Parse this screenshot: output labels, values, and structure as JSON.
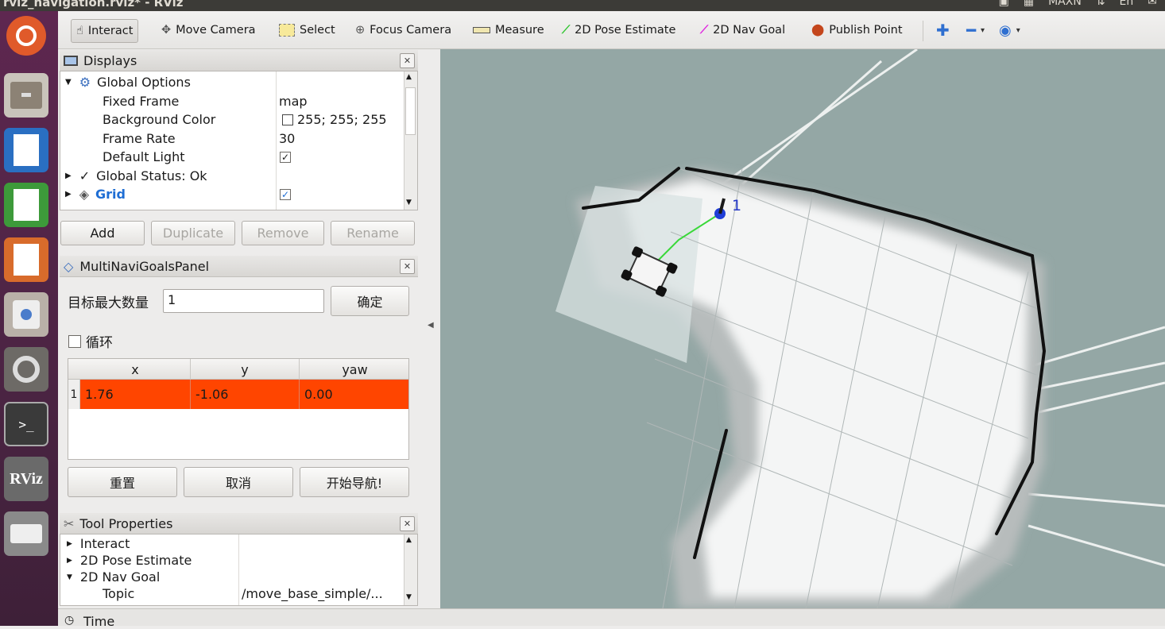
{
  "window": {
    "title": "rviz_navigation.rviz* - RViz"
  },
  "tray": {
    "indicator": "MAXN",
    "lang": "En"
  },
  "launcher": {
    "items": [
      {
        "name": "ubuntu-dash-icon"
      },
      {
        "name": "files-icon"
      },
      {
        "name": "writer-icon"
      },
      {
        "name": "calc-icon"
      },
      {
        "name": "impress-icon"
      },
      {
        "name": "software-center-icon"
      },
      {
        "name": "system-settings-icon"
      },
      {
        "name": "terminal-icon"
      },
      {
        "name": "rviz-app-icon",
        "label": "RViz"
      },
      {
        "name": "drive-icon"
      }
    ]
  },
  "toolbar": {
    "interact": "Interact",
    "move_camera": "Move Camera",
    "select": "Select",
    "focus_camera": "Focus Camera",
    "measure": "Measure",
    "pose_estimate": "2D Pose Estimate",
    "nav_goal": "2D Nav Goal",
    "publish_point": "Publish Point"
  },
  "displays": {
    "title": "Displays",
    "rows": [
      {
        "label": "Global Options",
        "value": ""
      },
      {
        "label": "Fixed Frame",
        "value": "map"
      },
      {
        "label": "Background Color",
        "value": "255; 255; 255"
      },
      {
        "label": "Frame Rate",
        "value": "30"
      },
      {
        "label": "Default Light",
        "value": "✓"
      },
      {
        "label": "Global Status: Ok",
        "value": ""
      },
      {
        "label": "Grid",
        "value": "✓"
      }
    ],
    "buttons": {
      "add": "Add",
      "duplicate": "Duplicate",
      "remove": "Remove",
      "rename": "Rename"
    }
  },
  "multinavi": {
    "title": "MultiNaviGoalsPanel",
    "max_label": "目标最大数量",
    "max_value": "1",
    "confirm": "确定",
    "loop_label": "循环",
    "columns": [
      "x",
      "y",
      "yaw"
    ],
    "rows": [
      {
        "index": "1",
        "x": "1.76",
        "y": "-1.06",
        "yaw": "0.00"
      }
    ],
    "buttons": {
      "reset": "重置",
      "cancel": "取消",
      "start": "开始导航!"
    }
  },
  "tool_props": {
    "title": "Tool Properties",
    "rows": [
      {
        "label": "Interact",
        "value": ""
      },
      {
        "label": "2D Pose Estimate",
        "value": ""
      },
      {
        "label": "2D Nav Goal",
        "value": ""
      },
      {
        "label": "Topic",
        "value": "/move_base_simple/..."
      }
    ]
  },
  "viewport": {
    "goal_marker_label": "1"
  },
  "status": {
    "time_label": "Time"
  },
  "colors": {
    "selected_row": "#ff4500",
    "grid_label": "#1f6ed4",
    "map_bg": "#94a7a5"
  }
}
